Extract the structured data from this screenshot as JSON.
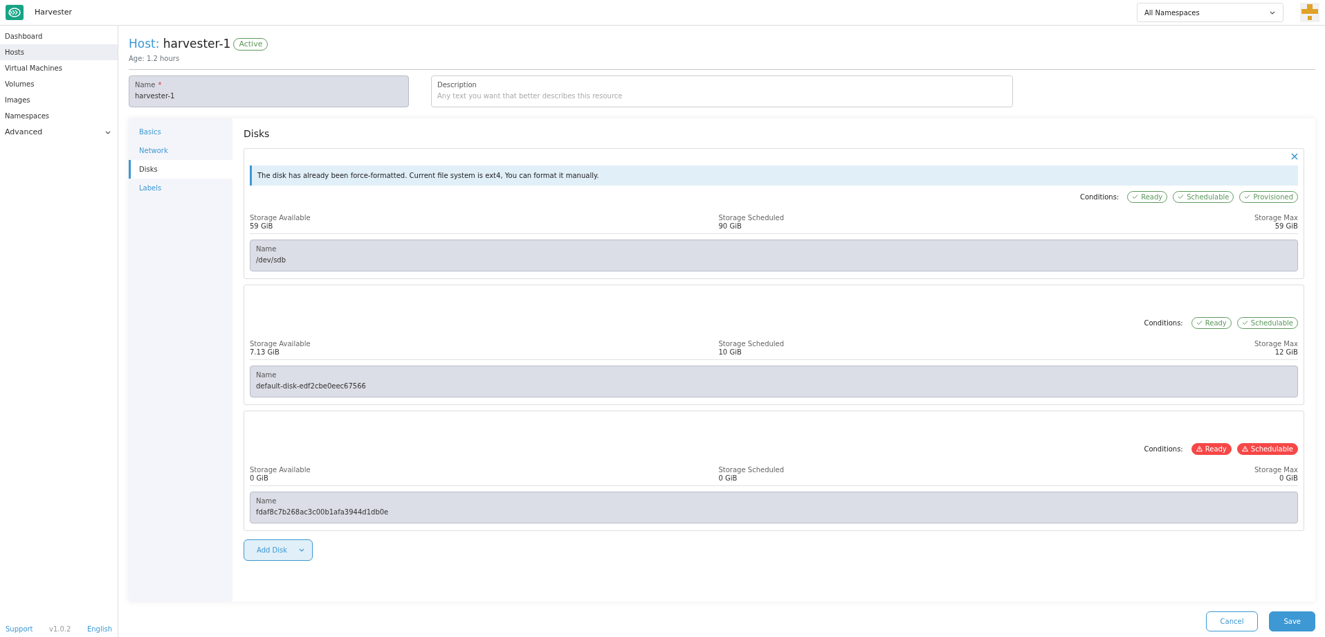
{
  "app": {
    "title": "Harvester"
  },
  "namespace_select": {
    "value": "All Namespaces"
  },
  "sidebar": {
    "items": [
      {
        "label": "Dashboard",
        "kind": "link",
        "selected": false
      },
      {
        "label": "Hosts",
        "kind": "link",
        "selected": true
      },
      {
        "label": "Virtual Machines",
        "kind": "link",
        "selected": false
      },
      {
        "label": "Volumes",
        "kind": "link",
        "selected": false
      },
      {
        "label": "Images",
        "kind": "link",
        "selected": false
      },
      {
        "label": "Namespaces",
        "kind": "link",
        "selected": false
      },
      {
        "label": "Advanced",
        "kind": "group",
        "selected": false,
        "expanded": false
      }
    ],
    "footer": [
      "Support",
      "v1.0.2",
      "English"
    ]
  },
  "header": {
    "kind_label": "Host:",
    "name": "harvester-1",
    "status": "Active",
    "age": "Age: 1.2 hours"
  },
  "fields": {
    "name": {
      "label": "Name",
      "required_mark": "*",
      "value": "harvester-1"
    },
    "description": {
      "label": "Description",
      "placeholder": "Any text you want that better describes this resource"
    }
  },
  "tabs": [
    {
      "label": "Basics",
      "selected": false
    },
    {
      "label": "Network",
      "selected": false
    },
    {
      "label": "Disks",
      "selected": true
    },
    {
      "label": "Labels",
      "selected": false
    }
  ],
  "section_title": "Disks",
  "disks": [
    {
      "removable": true,
      "banner": "The disk has already been force-formatted. Current file system is ext4, You can format it manually.",
      "conditions_label": "Conditions:",
      "conditions": [
        {
          "label": "Ready",
          "ok": true
        },
        {
          "label": "Schedulable",
          "ok": true
        },
        {
          "label": "Provisioned",
          "ok": true
        }
      ],
      "stats": [
        {
          "label": "Storage Available",
          "value": "59 GiB"
        },
        {
          "label": "Storage Scheduled",
          "value": "90 GiB"
        },
        {
          "label": "Storage Max",
          "value": "59 GiB"
        }
      ],
      "name_field": {
        "label": "Name",
        "value": "/dev/sdb"
      }
    },
    {
      "removable": false,
      "conditions_label": "Conditions:",
      "conditions": [
        {
          "label": "Ready",
          "ok": true
        },
        {
          "label": "Schedulable",
          "ok": true
        }
      ],
      "stats": [
        {
          "label": "Storage Available",
          "value": "7.13 GiB"
        },
        {
          "label": "Storage Scheduled",
          "value": "10 GiB"
        },
        {
          "label": "Storage Max",
          "value": "12 GiB"
        }
      ],
      "name_field": {
        "label": "Name",
        "value": "default-disk-edf2cbe0eec67566"
      }
    },
    {
      "removable": false,
      "conditions_label": "Conditions:",
      "conditions": [
        {
          "label": "Ready",
          "ok": false
        },
        {
          "label": "Schedulable",
          "ok": false
        }
      ],
      "stats": [
        {
          "label": "Storage Available",
          "value": "0 GiB"
        },
        {
          "label": "Storage Scheduled",
          "value": "0 GiB"
        },
        {
          "label": "Storage Max",
          "value": "0 GiB"
        }
      ],
      "name_field": {
        "label": "Name",
        "value": "fdaf8c7b268ac3c00b1afa3944d1db0e"
      }
    }
  ],
  "add_button": {
    "label": "Add Disk"
  },
  "actions": [
    {
      "label": "Cancel",
      "kind": "secondary"
    },
    {
      "label": "Save",
      "kind": "primary"
    }
  ]
}
